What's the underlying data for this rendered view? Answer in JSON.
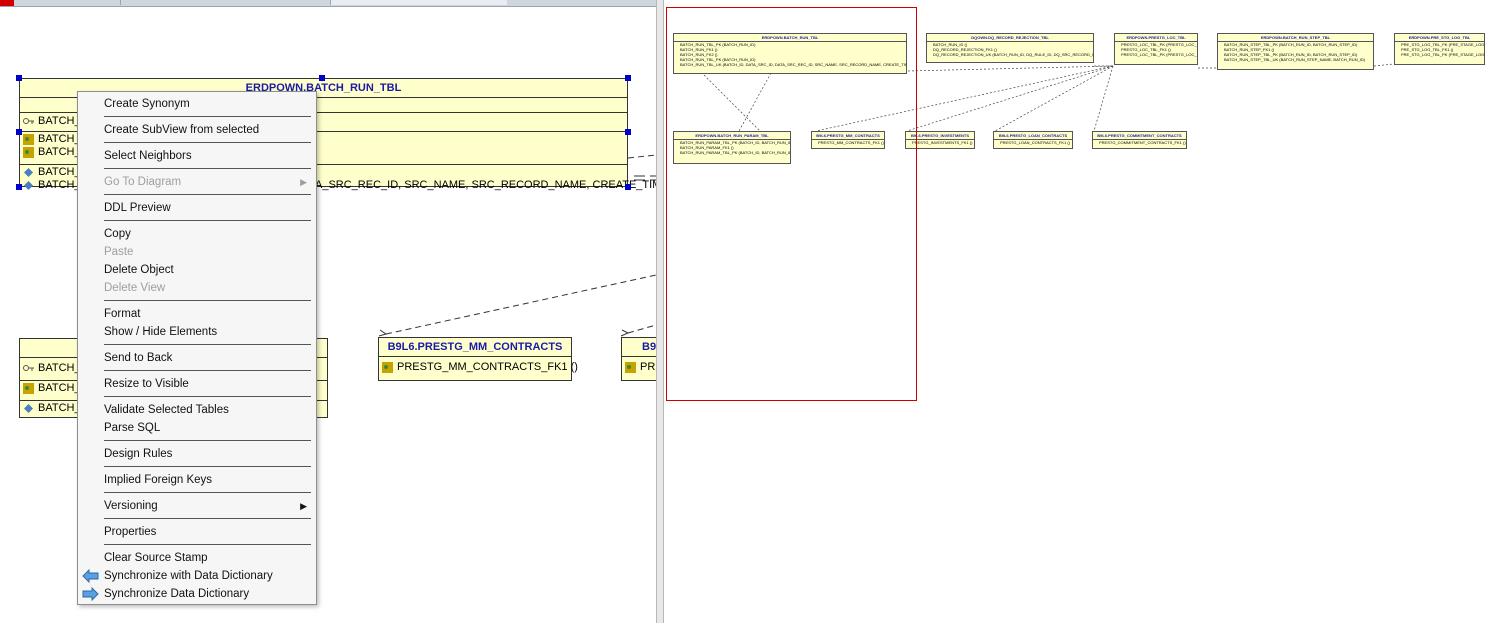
{
  "left": {
    "batch_run_tbl": {
      "title": "ERDPOWN.BATCH_RUN_TBL",
      "rows": [
        "BATCH_",
        "BATCH_",
        "BATCH_",
        "BATCH_",
        "BATCH_"
      ],
      "tail": "A_SRC_REC_ID, SRC_NAME, SRC_RECORD_NAME, CREATE_TIME)"
    },
    "param_tbl": {
      "rows": [
        "BATCH_",
        "BATCH_",
        "BATCH_"
      ]
    },
    "mm_contracts": {
      "title": "B9L6.PRESTG_MM_CONTRACTS",
      "row": "PRESTG_MM_CONTRACTS_FK1 ()"
    },
    "partial": {
      "title": "B9",
      "row": "PRE"
    }
  },
  "menu": {
    "items": [
      {
        "label": "Create Synonym"
      },
      {
        "label": "Create SubView from selected"
      },
      {
        "label": "Select Neighbors"
      },
      {
        "label": "Go To Diagram"
      },
      {
        "label": "DDL Preview"
      },
      {
        "label": "Copy"
      },
      {
        "label": "Paste"
      },
      {
        "label": "Delete Object"
      },
      {
        "label": "Delete View"
      },
      {
        "label": "Format"
      },
      {
        "label": "Show / Hide Elements"
      },
      {
        "label": "Send to Back"
      },
      {
        "label": "Resize to Visible"
      },
      {
        "label": "Validate Selected Tables"
      },
      {
        "label": "Parse SQL"
      },
      {
        "label": "Design Rules"
      },
      {
        "label": "Implied Foreign Keys"
      },
      {
        "label": "Versioning"
      },
      {
        "label": "Properties"
      },
      {
        "label": "Clear Source Stamp"
      },
      {
        "label": "Synchronize with Data Dictionary"
      },
      {
        "label": "Synchronize Data Dictionary"
      }
    ]
  },
  "mini": {
    "tables": [
      {
        "title": "ERDPOWN.BATCH_RUN_TBL",
        "rows": [
          "BATCH_RUN_TBL_PK (BATCH_RUN_ID)",
          "BATCH_RUN_FK1 ()",
          "BATCH_RUN_FK2 ()",
          "BATCH_RUN_TBL_PK (BATCH_RUN_ID)",
          "BATCH_RUN_TBL_UK (BATCH_ID, DATA_SRC_ID, DATA_SRC_REC_ID, SRC_NAME, SRC_RECORD_NAME, CREATE_TIME)"
        ]
      },
      {
        "title": "DQOWN.DQ_RECORD_REJECTION_TBL",
        "rows": [
          "BATCH_RUN_ID ()",
          "DQ_RECORD_REJECTION_FK1 ()",
          "DQ_RECORD_REJECTION_UK (BATCH_RUN_ID, DQ_RULE_ID, DQ_SRC_RECORD_ID)"
        ]
      },
      {
        "title": "ERDPOWN.PRESTG_LOC_TBL",
        "rows": [
          "PRESTG_LOC_TBL_PK (PRESTG_LOC_ID)",
          "PRESTG_LOC_TBL_FK1 ()",
          "PRESTG_LOC_TBL_PK (PRESTG_LOC_ID)"
        ]
      },
      {
        "title": "ERDPOWN.BATCH_RUN_STEP_TBL",
        "rows": [
          "BATCH_RUN_STEP_TBL_PK (BATCH_RUN_ID, BATCH_RUN_STEP_ID)",
          "BATCH_RUN_STEP_FK1 ()",
          "BATCH_RUN_STEP_TBL_PK (BATCH_RUN_ID, BATCH_RUN_STEP_ID)",
          "BATCH_RUN_STEP_TBL_UK (BATCH_RUN_STEP_NAME, BATCH_RUN_ID)"
        ]
      },
      {
        "title": "ERDPOWN.PRE_STG_LOG_TBL",
        "rows": [
          "PRE_STG_LOG_TBL_PK (PRE_STAGE_LOG_ID)",
          "PRE_STG_LOG_TBL_FK1 ()",
          "PRE_STG_LOG_TBL_PK (PRE_STAGE_LOG_ID)"
        ]
      },
      {
        "title": "ERDPOWN.BATCH_RUN_PARAM_TBL",
        "rows": [
          "BATCH_RUN_PARAM_TBL_PK (BATCH_ID, BATCH_RUN_ID)",
          "BATCH_RUN_PARAM_FK1 ()",
          "BATCH_RUN_PARAM_TBL_PK (BATCH_ID, BATCH_RUN_ID)"
        ]
      },
      {
        "title": "B9L6.PRESTG_MM_CONTRACTS",
        "rows": [
          "PRESTG_MM_CONTRACTS_FK1 ()"
        ]
      },
      {
        "title": "B9L6.PRESTG_INVESTMENTS",
        "rows": [
          "PRESTG_INVESTMENTS_FK1 ()"
        ]
      },
      {
        "title": "B9L6.PRESTG_LOAN_CONTRACTS",
        "rows": [
          "PRESTG_LOAN_CONTRACTS_FK1 ()"
        ]
      },
      {
        "title": "B9L6.PRESTG_COMMITMENT_CONTRACTS",
        "rows": [
          "PRESTG_COMMITMENT_CONTRACTS_FK1 ()"
        ]
      }
    ]
  },
  "colors": {
    "accent": "#1a1aa6",
    "table_bg": "#ffffcc",
    "selection": "#0000cc",
    "viewport": "#cc0000"
  }
}
